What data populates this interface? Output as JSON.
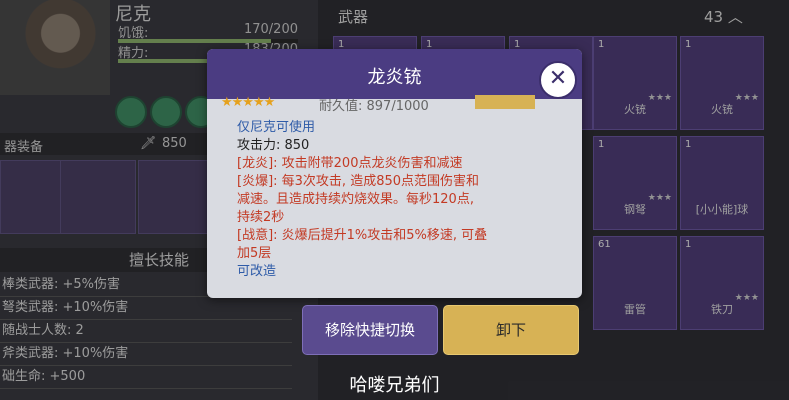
{
  "character": {
    "name": "尼克",
    "stats": [
      {
        "label": "饥饿:",
        "value": "170/200",
        "fill": 0.85
      },
      {
        "label": "精力:",
        "value": "183/200",
        "fill": 0.915
      }
    ],
    "equip_title": "器装备",
    "equip_power": "850"
  },
  "skills": {
    "title": "擅长技能",
    "rows": [
      "棒类武器: +5%伤害",
      "弩类武器: +10%伤害",
      "随战士人数: 2",
      "斧类武器: +10%伤害",
      "础生命: +500"
    ]
  },
  "weapons_panel": {
    "title": "武器",
    "count": "43",
    "cells": [
      {
        "qty": "1",
        "name": "",
        "stars": "★★★"
      },
      {
        "qty": "1",
        "name": "",
        "stars": ""
      },
      {
        "qty": "1",
        "name": "",
        "stars": ""
      },
      {
        "qty": "1",
        "name": "火铳",
        "stars": "★★★"
      },
      {
        "qty": "1",
        "name": "火铳",
        "stars": "★★★"
      },
      {
        "qty": "1",
        "name": "钢弩",
        "stars": "★★★"
      },
      {
        "qty": "1",
        "name": "[小小能]球",
        "stars": ""
      },
      {
        "qty": "61",
        "name": "雷管",
        "stars": ""
      },
      {
        "qty": "1",
        "name": "铁刀",
        "stars": "★★★"
      }
    ]
  },
  "modal": {
    "title": "龙炎铳",
    "close_label": "✕",
    "stars": "★★★★★",
    "durability": "耐久值: 897/1000",
    "lines": [
      {
        "text": "仅尼克可使用",
        "color": "blue"
      },
      {
        "text": "攻击力: 850",
        "color": "black"
      },
      {
        "text": "[龙炎]: 攻击附带200点龙炎伤害和减速",
        "color": "red"
      },
      {
        "text": "[炎爆]: 每3次攻击, 造成850点范围伤害和",
        "color": "red"
      },
      {
        "text": "减速。且造成持续灼烧效果。每秒120点,",
        "color": "red"
      },
      {
        "text": "持续2秒",
        "color": "red"
      },
      {
        "text": "[战意]: 炎爆后提升1%攻击和5%移速, 可叠",
        "color": "red"
      },
      {
        "text": "加5层",
        "color": "red"
      },
      {
        "text": "可改造",
        "color": "blue"
      }
    ]
  },
  "actions": {
    "remove_quick_switch": "移除快捷切换",
    "unequip": "卸下"
  },
  "subtitle": "哈喽兄弟们"
}
